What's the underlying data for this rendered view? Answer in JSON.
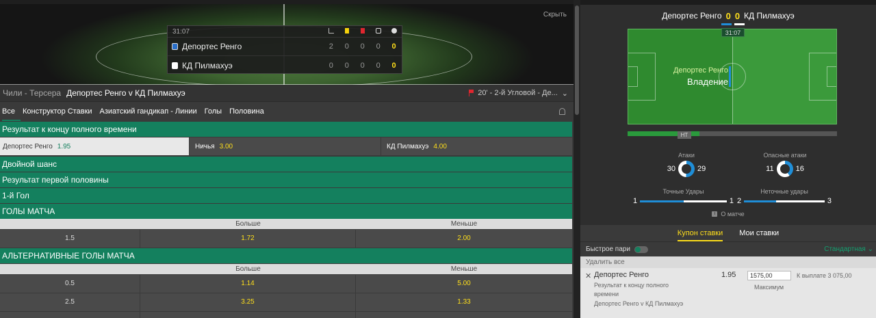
{
  "hero": {
    "hide_label": "Скрыть"
  },
  "scoreboard": {
    "clock": "31:07",
    "teams": [
      {
        "name": "Депортес Ренго",
        "corners": "2",
        "yellow": "0",
        "red": "0",
        "subs": "0",
        "goals": "0",
        "kit_color": "#2a6fc9"
      },
      {
        "name": "КД Пилмахуэ",
        "corners": "0",
        "yellow": "0",
        "red": "0",
        "subs": "0",
        "goals": "0",
        "kit_color": "#ffffff"
      }
    ]
  },
  "event": {
    "league": "Чили - Терсера",
    "title": "Депортес Ренго v КД Пилмахуэ",
    "status": "20' - 2-й Угловой - Де..."
  },
  "tabs": [
    "Все",
    "Конструктор Ставки",
    "Азиатский гандикап - Линии",
    "Голы",
    "Половина"
  ],
  "markets": {
    "fulltime": {
      "title": "Результат к концу полного времени",
      "home_label": "Депортес Ренго",
      "home_price": "1.95",
      "draw_label": "Ничья",
      "draw_price": "3.00",
      "away_label": "КД Пилмахуэ",
      "away_price": "4.00"
    },
    "double_chance": "Двойной шанс",
    "first_half": "Результат первой половины",
    "first_goal": "1-й Гол",
    "match_goals": {
      "title": "ГОЛЫ МАТЧА",
      "over": "Больше",
      "under": "Меньше",
      "rows": [
        {
          "line": "1.5",
          "over": "1.72",
          "under": "2.00"
        }
      ]
    },
    "alt_goals": {
      "title": "АЛЬТЕРНАТИВНЫЕ ГОЛЫ МАТЧА",
      "over": "Больше",
      "under": "Меньше",
      "rows": [
        {
          "line": "0.5",
          "over": "1.14",
          "under": "5.00"
        },
        {
          "line": "2.5",
          "over": "3.25",
          "under": "1.33"
        }
      ]
    }
  },
  "tracker": {
    "home": "Депортес Ренго",
    "away": "КД Пилмахуэ",
    "home_score": "0",
    "away_score": "0",
    "clock": "31:07",
    "possession_team": "Депортес Ренго",
    "possession_label": "Владение",
    "ht_label": "HT",
    "elapsed_fraction": 0.344,
    "attacks": {
      "label": "Атаки",
      "home": "30",
      "away": "29",
      "home_share": 0.508
    },
    "dangerous": {
      "label": "Опасные атаки",
      "home": "11",
      "away": "16",
      "home_share": 0.407
    },
    "on_target": {
      "label": "Точные Удары",
      "home": "1",
      "away": "1",
      "home_share": 0.5
    },
    "off_target": {
      "label": "Неточные удары",
      "home": "2",
      "away": "3",
      "home_share": 0.4
    },
    "about": "О матче",
    "home_color": "#1f8ed8",
    "away_color": "#ffffff"
  },
  "betslip": {
    "tab_slip": "Купон ставки",
    "tab_mybets": "Мои ставки",
    "quick_label": "Быстрое пари",
    "mode": "Стандартная",
    "remove_all": "Удалить все",
    "selection": "Депортес Ренго",
    "price": "1.95",
    "market": "Результат к концу полного времени",
    "event": "Депортес Ренго v КД Пилмахуэ",
    "stake": "1575,00",
    "payout": "К выплате 3 075,00",
    "max": "Максимум"
  }
}
